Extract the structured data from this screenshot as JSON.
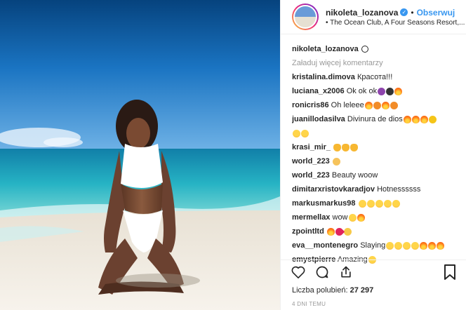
{
  "post": {
    "username": "nikoleta_lozanova",
    "follow_label": "Obserwuj",
    "location": "The Ocean Club, A Four Seasons Resort,...",
    "likes_label": "Liczba polubień:",
    "likes_count": "27 297",
    "date": "4 DNI TEMU"
  },
  "caption": {
    "username": "nikoleta_lozanova"
  },
  "load_more": "Załaduj więcej komentarzy",
  "comments": [
    {
      "user": "kristalina.dimova",
      "text": "Красота!!!",
      "emoji": []
    },
    {
      "user": "luciana_x2006",
      "text": "Ok ok ok",
      "emoji": [
        "purple",
        "bomb",
        "fire"
      ]
    },
    {
      "user": "ronicris86",
      "text": "Oh leleee",
      "emoji": [
        "fire",
        "tongue",
        "fire",
        "tongue"
      ]
    },
    {
      "user": "juanillodasilva",
      "text": "Divinura de dios",
      "emoji": [
        "fire",
        "fire",
        "fire",
        "cool"
      ]
    },
    {
      "user": "",
      "text": "",
      "emoji": [
        "grin",
        "grin"
      ]
    },
    {
      "user": "krasi_mir_",
      "text": "",
      "emoji": [
        "cat",
        "cat",
        "cat"
      ]
    },
    {
      "user": "world_223",
      "text": "",
      "emoji": [
        "clap"
      ]
    },
    {
      "user": "world_223",
      "text": "Beauty woow",
      "emoji": []
    },
    {
      "user": "dimitarxristovkaradjov",
      "text": "Hotnessssss",
      "emoji": []
    },
    {
      "user": "markusmarkus98",
      "text": "",
      "emoji": [
        "grin",
        "grin",
        "grin",
        "grin",
        "grin"
      ]
    },
    {
      "user": "mermellax",
      "text": "wow",
      "emoji": [
        "grin",
        "fire"
      ]
    },
    {
      "user": "zpointltd",
      "text": "",
      "emoji": [
        "fire",
        "heart",
        "wow"
      ]
    },
    {
      "user": "eva__montenegro",
      "text": "Slaying",
      "emoji": [
        "grin",
        "grin",
        "grin",
        "grin",
        "fire",
        "fire",
        "fire"
      ]
    },
    {
      "user": "emystpierre",
      "text": "Amazing",
      "emoji": [
        "grin"
      ]
    }
  ],
  "icons": {
    "verified": "verified-badge-icon",
    "comment_bubble": "comment-bubble-icon",
    "like": "heart-icon",
    "comment": "comment-icon",
    "share": "share-icon",
    "save": "bookmark-icon"
  },
  "colors": {
    "accent": "#3897f0",
    "muted": "#999999",
    "text": "#262626"
  }
}
